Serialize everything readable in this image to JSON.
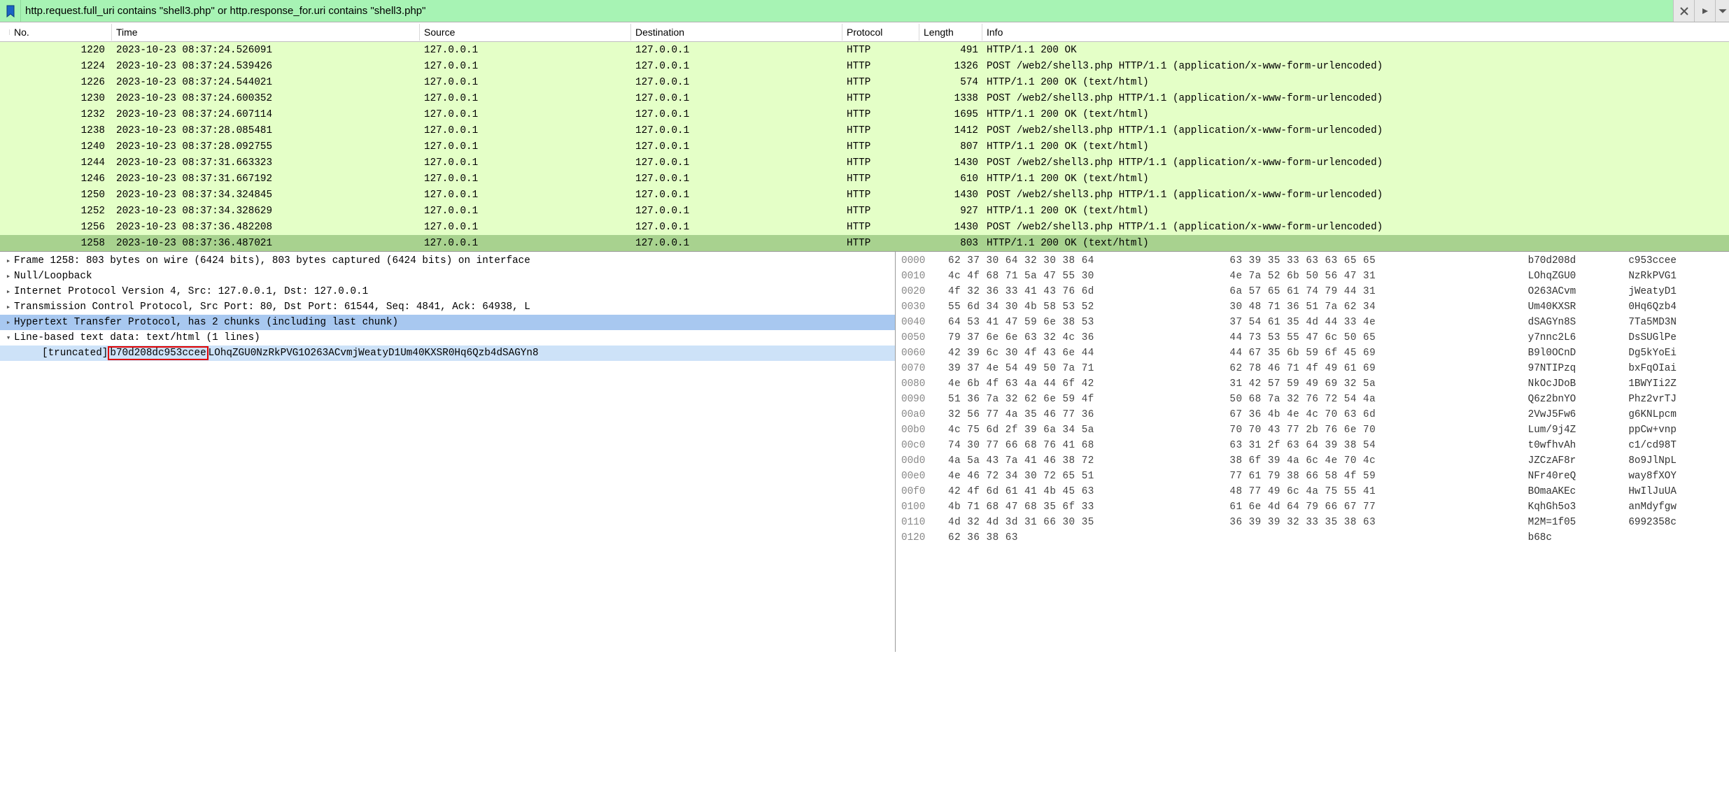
{
  "filter": {
    "text": "http.request.full_uri contains \"shell3.php\" or http.response_for.uri contains \"shell3.php\""
  },
  "columns": {
    "no": "No.",
    "time": "Time",
    "source": "Source",
    "destination": "Destination",
    "protocol": "Protocol",
    "length": "Length",
    "info": "Info"
  },
  "packets": [
    {
      "no": "1220",
      "time": "2023-10-23 08:37:24.526091",
      "src": "127.0.0.1",
      "dst": "127.0.0.1",
      "proto": "HTTP",
      "len": "491",
      "info": "HTTP/1.1 200 OK ",
      "gutter": ""
    },
    {
      "no": "1224",
      "time": "2023-10-23 08:37:24.539426",
      "src": "127.0.0.1",
      "dst": "127.0.0.1",
      "proto": "HTTP",
      "len": "1326",
      "info": "POST /web2/shell3.php HTTP/1.1  (application/x-www-form-urlencoded)",
      "gutter": ""
    },
    {
      "no": "1226",
      "time": "2023-10-23 08:37:24.544021",
      "src": "127.0.0.1",
      "dst": "127.0.0.1",
      "proto": "HTTP",
      "len": "574",
      "info": "HTTP/1.1 200 OK  (text/html)",
      "gutter": ""
    },
    {
      "no": "1230",
      "time": "2023-10-23 08:37:24.600352",
      "src": "127.0.0.1",
      "dst": "127.0.0.1",
      "proto": "HTTP",
      "len": "1338",
      "info": "POST /web2/shell3.php HTTP/1.1  (application/x-www-form-urlencoded)",
      "gutter": ""
    },
    {
      "no": "1232",
      "time": "2023-10-23 08:37:24.607114",
      "src": "127.0.0.1",
      "dst": "127.0.0.1",
      "proto": "HTTP",
      "len": "1695",
      "info": "HTTP/1.1 200 OK  (text/html)",
      "gutter": ""
    },
    {
      "no": "1238",
      "time": "2023-10-23 08:37:28.085481",
      "src": "127.0.0.1",
      "dst": "127.0.0.1",
      "proto": "HTTP",
      "len": "1412",
      "info": "POST /web2/shell3.php HTTP/1.1  (application/x-www-form-urlencoded)",
      "gutter": ""
    },
    {
      "no": "1240",
      "time": "2023-10-23 08:37:28.092755",
      "src": "127.0.0.1",
      "dst": "127.0.0.1",
      "proto": "HTTP",
      "len": "807",
      "info": "HTTP/1.1 200 OK  (text/html)",
      "gutter": ""
    },
    {
      "no": "1244",
      "time": "2023-10-23 08:37:31.663323",
      "src": "127.0.0.1",
      "dst": "127.0.0.1",
      "proto": "HTTP",
      "len": "1430",
      "info": "POST /web2/shell3.php HTTP/1.1  (application/x-www-form-urlencoded)",
      "gutter": ""
    },
    {
      "no": "1246",
      "time": "2023-10-23 08:37:31.667192",
      "src": "127.0.0.1",
      "dst": "127.0.0.1",
      "proto": "HTTP",
      "len": "610",
      "info": "HTTP/1.1 200 OK  (text/html)",
      "gutter": ""
    },
    {
      "no": "1250",
      "time": "2023-10-23 08:37:34.324845",
      "src": "127.0.0.1",
      "dst": "127.0.0.1",
      "proto": "HTTP",
      "len": "1430",
      "info": "POST /web2/shell3.php HTTP/1.1  (application/x-www-form-urlencoded)",
      "gutter": "dot"
    },
    {
      "no": "1252",
      "time": "2023-10-23 08:37:34.328629",
      "src": "127.0.0.1",
      "dst": "127.0.0.1",
      "proto": "HTTP",
      "len": "927",
      "info": "HTTP/1.1 200 OK  (text/html)",
      "gutter": "dot"
    },
    {
      "no": "1256",
      "time": "2023-10-23 08:37:36.482208",
      "src": "127.0.0.1",
      "dst": "127.0.0.1",
      "proto": "HTTP",
      "len": "1430",
      "info": "POST /web2/shell3.php HTTP/1.1  (application/x-www-form-urlencoded)",
      "gutter": "arrow"
    },
    {
      "no": "1258",
      "time": "2023-10-23 08:37:36.487021",
      "src": "127.0.0.1",
      "dst": "127.0.0.1",
      "proto": "HTTP",
      "len": "803",
      "info": "HTTP/1.1 200 OK  (text/html)",
      "gutter": "arrow",
      "selected": true
    }
  ],
  "tree": [
    {
      "text": "Frame 1258: 803 bytes on wire (6424 bits), 803 bytes captured (6424 bits) on interface",
      "caret": ">",
      "cls": ""
    },
    {
      "text": "Null/Loopback",
      "caret": ">",
      "cls": ""
    },
    {
      "text": "Internet Protocol Version 4, Src: 127.0.0.1, Dst: 127.0.0.1",
      "caret": ">",
      "cls": ""
    },
    {
      "text": "Transmission Control Protocol, Src Port: 80, Dst Port: 61544, Seq: 4841, Ack: 64938, L",
      "caret": ">",
      "cls": ""
    },
    {
      "text": "Hypertext Transfer Protocol, has 2 chunks (including last chunk)",
      "caret": ">",
      "cls": "hi1"
    },
    {
      "text": "Line-based text data: text/html (1 lines)",
      "caret": "v",
      "cls": ""
    }
  ],
  "truncated_label": "[truncated]",
  "truncated_mark": "b70d208dc953ccee",
  "truncated_rest": "LOhqZGU0NzRkPVG1O263ACvmjWeatyD1Um40KXSR0Hq6Qzb4dSAGYn8",
  "hex": [
    {
      "off": "0000",
      "a": "62 37 30 64 32 30 38 64",
      "b": "63 39 35 33 63 63 65 65",
      "ta": "b70d208d",
      "tb": "c953ccee"
    },
    {
      "off": "0010",
      "a": "4c 4f 68 71 5a 47 55 30",
      "b": "4e 7a 52 6b 50 56 47 31",
      "ta": "LOhqZGU0",
      "tb": "NzRkPVG1"
    },
    {
      "off": "0020",
      "a": "4f 32 36 33 41 43 76 6d",
      "b": "6a 57 65 61 74 79 44 31",
      "ta": "O263ACvm",
      "tb": "jWeatyD1"
    },
    {
      "off": "0030",
      "a": "55 6d 34 30 4b 58 53 52",
      "b": "30 48 71 36 51 7a 62 34",
      "ta": "Um40KXSR",
      "tb": "0Hq6Qzb4"
    },
    {
      "off": "0040",
      "a": "64 53 41 47 59 6e 38 53",
      "b": "37 54 61 35 4d 44 33 4e",
      "ta": "dSAGYn8S",
      "tb": "7Ta5MD3N"
    },
    {
      "off": "0050",
      "a": "79 37 6e 6e 63 32 4c 36",
      "b": "44 73 53 55 47 6c 50 65",
      "ta": "y7nnc2L6",
      "tb": "DsSUGlPe"
    },
    {
      "off": "0060",
      "a": "42 39 6c 30 4f 43 6e 44",
      "b": "44 67 35 6b 59 6f 45 69",
      "ta": "B9l0OCnD",
      "tb": "Dg5kYoEi"
    },
    {
      "off": "0070",
      "a": "39 37 4e 54 49 50 7a 71",
      "b": "62 78 46 71 4f 49 61 69",
      "ta": "97NTIPzq",
      "tb": "bxFqOIai"
    },
    {
      "off": "0080",
      "a": "4e 6b 4f 63 4a 44 6f 42",
      "b": "31 42 57 59 49 69 32 5a",
      "ta": "NkOcJDoB",
      "tb": "1BWYIi2Z"
    },
    {
      "off": "0090",
      "a": "51 36 7a 32 62 6e 59 4f",
      "b": "50 68 7a 32 76 72 54 4a",
      "ta": "Q6z2bnYO",
      "tb": "Phz2vrTJ"
    },
    {
      "off": "00a0",
      "a": "32 56 77 4a 35 46 77 36",
      "b": "67 36 4b 4e 4c 70 63 6d",
      "ta": "2VwJ5Fw6",
      "tb": "g6KNLpcm"
    },
    {
      "off": "00b0",
      "a": "4c 75 6d 2f 39 6a 34 5a",
      "b": "70 70 43 77 2b 76 6e 70",
      "ta": "Lum/9j4Z",
      "tb": "ppCw+vnp"
    },
    {
      "off": "00c0",
      "a": "74 30 77 66 68 76 41 68",
      "b": "63 31 2f 63 64 39 38 54",
      "ta": "t0wfhvAh",
      "tb": "c1/cd98T"
    },
    {
      "off": "00d0",
      "a": "4a 5a 43 7a 41 46 38 72",
      "b": "38 6f 39 4a 6c 4e 70 4c",
      "ta": "JZCzAF8r",
      "tb": "8o9JlNpL"
    },
    {
      "off": "00e0",
      "a": "4e 46 72 34 30 72 65 51",
      "b": "77 61 79 38 66 58 4f 59",
      "ta": "NFr40reQ",
      "tb": "way8fXOY"
    },
    {
      "off": "00f0",
      "a": "42 4f 6d 61 41 4b 45 63",
      "b": "48 77 49 6c 4a 75 55 41",
      "ta": "BOmaAKEc",
      "tb": "HwIlJuUA"
    },
    {
      "off": "0100",
      "a": "4b 71 68 47 68 35 6f 33",
      "b": "61 6e 4d 64 79 66 67 77",
      "ta": "KqhGh5o3",
      "tb": "anMdyfgw"
    },
    {
      "off": "0110",
      "a": "4d 32 4d 3d 31 66 30 35",
      "b": "36 39 39 32 33 35 38 63",
      "ta": "M2M=1f05",
      "tb": "6992358c"
    },
    {
      "off": "0120",
      "a": "62 36 38 63",
      "b": "",
      "ta": "b68c",
      "tb": ""
    }
  ]
}
